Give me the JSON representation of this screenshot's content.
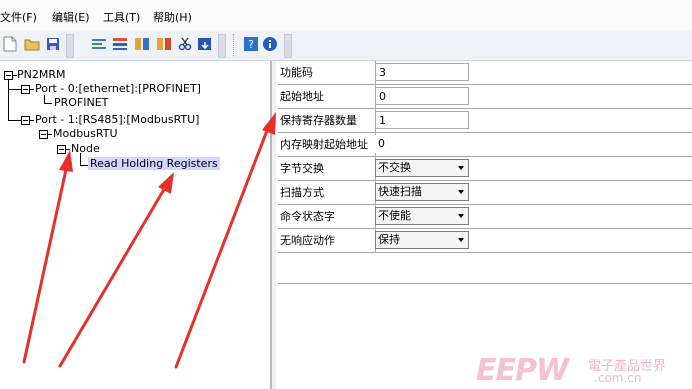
{
  "menu": {
    "file": "文件(F)",
    "edit": "编辑(E)",
    "tools": "工具(T)",
    "help": "帮助(H)"
  },
  "toolbar": {
    "icons": [
      "new-file-icon",
      "open-folder-icon",
      "save-icon",
      "config-icon",
      "list-icon",
      "tool-a-icon",
      "tool-b-icon",
      "scissors-icon",
      "download-icon",
      "help-icon",
      "info-icon"
    ]
  },
  "tree": {
    "root": "PN2MRM",
    "port0": "Port - 0:[ethernet]:[PROFINET]",
    "profinet": "PROFINET",
    "port1": "Port - 1:[RS485]:[ModbusRTU]",
    "modbus": "ModbusRTU",
    "node": "Node",
    "command": "Read Holding Registers"
  },
  "properties": [
    {
      "label": "功能码",
      "value": "3",
      "type": "text"
    },
    {
      "label": "起始地址",
      "value": "0",
      "type": "text"
    },
    {
      "label": "保持寄存器数量",
      "value": "1",
      "type": "text"
    },
    {
      "label": "内存映射起始地址",
      "value": "0",
      "type": "text"
    },
    {
      "label": "字节交换",
      "value": "不交换",
      "type": "select"
    },
    {
      "label": "扫描方式",
      "value": "快速扫描",
      "type": "select"
    },
    {
      "label": "命令状态字",
      "value": "不使能",
      "type": "select"
    },
    {
      "label": "无响应动作",
      "value": "保持",
      "type": "select"
    }
  ],
  "watermark": {
    "brand": "EEPW",
    "cn": "電子產品世界",
    "domain": ".com.cn"
  },
  "colors": {
    "arrow": "#e8302a",
    "selection": "#cfd7ff",
    "watermark": "#f4c2cc"
  }
}
